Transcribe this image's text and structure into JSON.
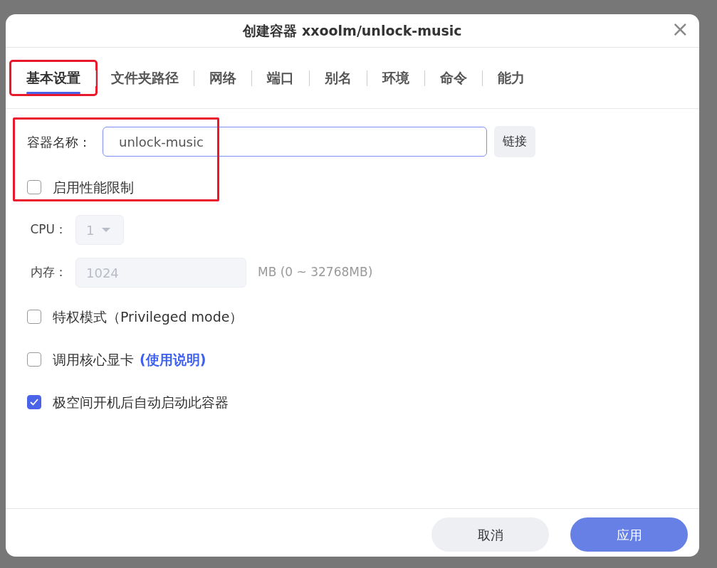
{
  "dialog": {
    "title": "创建容器 xxoolm/unlock-music",
    "close": "×"
  },
  "tabs": [
    {
      "label": "基本设置",
      "selected": true,
      "highlighted": true
    },
    {
      "label": "文件夹路径",
      "selected": false,
      "highlighted": false
    },
    {
      "label": "网络",
      "selected": false,
      "highlighted": false
    },
    {
      "label": "端口",
      "selected": false,
      "highlighted": false
    },
    {
      "label": "别名",
      "selected": false,
      "highlighted": false
    },
    {
      "label": "环境",
      "selected": false,
      "highlighted": false
    },
    {
      "label": "命令",
      "selected": false,
      "highlighted": false
    },
    {
      "label": "能力",
      "selected": false,
      "highlighted": false
    }
  ],
  "name_field": {
    "label": "容器名称：",
    "value": "unlock-music",
    "button": "链接"
  },
  "highlight_box": true,
  "limit": {
    "label": "启用性能限制",
    "checked": false
  },
  "cpu": {
    "label": "CPU：",
    "value": "1",
    "disabled": true
  },
  "memory": {
    "label": "内存：",
    "value": "1024",
    "hint": "MB (0 ~ 32768MB)",
    "disabled": true
  },
  "options": [
    {
      "label": "特权模式（Privileged mode）",
      "checked": false
    },
    {
      "label": "调用核心显卡",
      "link": "(使用说明)",
      "checked": false
    },
    {
      "label": "极空间开机后自动启动此容器",
      "checked": true
    }
  ],
  "buttons": [
    {
      "label": "取消",
      "kind": "secondary"
    },
    {
      "label": "应用",
      "kind": "primary"
    }
  ]
}
